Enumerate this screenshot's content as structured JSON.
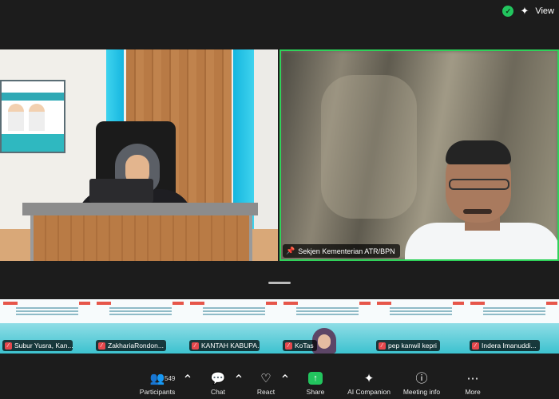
{
  "window": {
    "view_label": "View",
    "icons": [
      "shield-check-icon",
      "sparkle-icon"
    ]
  },
  "main": {
    "presenter_tile": {
      "name": ""
    },
    "speaker_tile": {
      "name": "Sekjen Kementerian ATR/BPN",
      "pinned": true,
      "active_speaker_color": "#2fd15a"
    }
  },
  "gallery": {
    "participants": [
      {
        "name": "Subur Yusra, Kan..."
      },
      {
        "name": "ZakhariaRondon..."
      },
      {
        "name": "KANTAH KABUPA..."
      },
      {
        "name": "KoTas"
      },
      {
        "name": "pep kanwil kepri"
      },
      {
        "name": "Indera Imanuddi..."
      }
    ]
  },
  "toolbar": {
    "participants_label": "Participants",
    "participants_count": "549",
    "chat_label": "Chat",
    "react_label": "React",
    "share_label": "Share",
    "ai_label": "AI Companion",
    "meeting_info_label": "Meeting info",
    "more_label": "More",
    "share_color": "#22c55e"
  }
}
